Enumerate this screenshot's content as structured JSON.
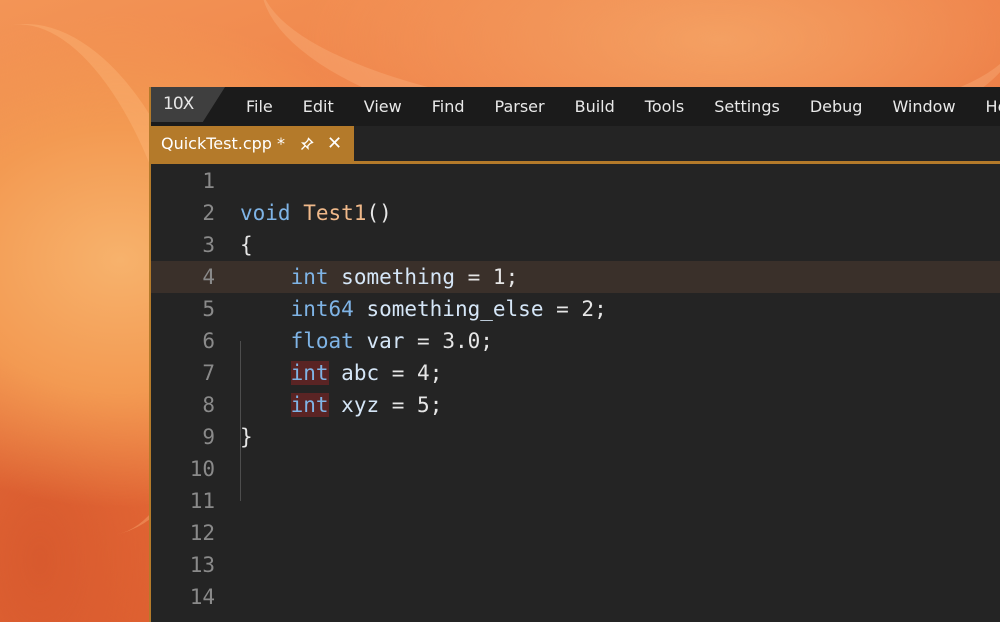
{
  "app": {
    "logo_text": "10X"
  },
  "menu": {
    "items": [
      "File",
      "Edit",
      "View",
      "Find",
      "Parser",
      "Build",
      "Tools",
      "Settings",
      "Debug",
      "Window",
      "Help"
    ]
  },
  "tab": {
    "label": "QuickTest.cpp *",
    "pin_icon": "pin-icon",
    "close_glyph": "✕"
  },
  "editor": {
    "current_line": 4,
    "lines": [
      {
        "num": "1",
        "tokens": []
      },
      {
        "num": "2",
        "tokens": [
          [
            "kw-void",
            "void"
          ],
          [
            "punc",
            " "
          ],
          [
            "fn",
            "Test1"
          ],
          [
            "punc",
            "()"
          ]
        ]
      },
      {
        "num": "3",
        "tokens": [
          [
            "punc",
            "{"
          ]
        ]
      },
      {
        "num": "4",
        "tokens": [
          [
            "punc",
            "    "
          ],
          [
            "kw-type",
            "int"
          ],
          [
            "punc",
            " "
          ],
          [
            "ident",
            "something"
          ],
          [
            "punc",
            " = "
          ],
          [
            "num",
            "1"
          ],
          [
            "punc",
            ";"
          ]
        ]
      },
      {
        "num": "5",
        "tokens": [
          [
            "punc",
            "    "
          ],
          [
            "kw-type",
            "int64"
          ],
          [
            "punc",
            " "
          ],
          [
            "ident",
            "something_else"
          ],
          [
            "punc",
            " = "
          ],
          [
            "num",
            "2"
          ],
          [
            "punc",
            ";"
          ]
        ]
      },
      {
        "num": "6",
        "tokens": [
          [
            "punc",
            "    "
          ],
          [
            "kw-type",
            "float"
          ],
          [
            "punc",
            " "
          ],
          [
            "ident",
            "var"
          ],
          [
            "punc",
            " = "
          ],
          [
            "num",
            "3.0"
          ],
          [
            "punc",
            ";"
          ]
        ]
      },
      {
        "num": "7",
        "tokens": [
          [
            "punc",
            "    "
          ],
          [
            "kw-type hl",
            "int"
          ],
          [
            "punc",
            " "
          ],
          [
            "ident",
            "abc"
          ],
          [
            "punc",
            " = "
          ],
          [
            "num",
            "4"
          ],
          [
            "punc",
            ";"
          ]
        ]
      },
      {
        "num": "8",
        "tokens": [
          [
            "punc",
            "    "
          ],
          [
            "kw-type hl",
            "int"
          ],
          [
            "punc",
            " "
          ],
          [
            "ident",
            "xyz"
          ],
          [
            "punc",
            " = "
          ],
          [
            "num",
            "5"
          ],
          [
            "punc",
            ";"
          ]
        ]
      },
      {
        "num": "9",
        "tokens": [
          [
            "punc",
            "}"
          ]
        ]
      },
      {
        "num": "10",
        "tokens": []
      },
      {
        "num": "11",
        "tokens": []
      },
      {
        "num": "12",
        "tokens": []
      },
      {
        "num": "13",
        "tokens": []
      },
      {
        "num": "14",
        "tokens": []
      }
    ]
  },
  "colors": {
    "accent": "#b47a2a",
    "editor_bg": "#242424",
    "menubar_bg": "#1b1b1b",
    "keyword": "#7fb4e6",
    "function": "#f0b98a",
    "identifier": "#d5e6f7",
    "line_number": "#8a8a8a"
  }
}
